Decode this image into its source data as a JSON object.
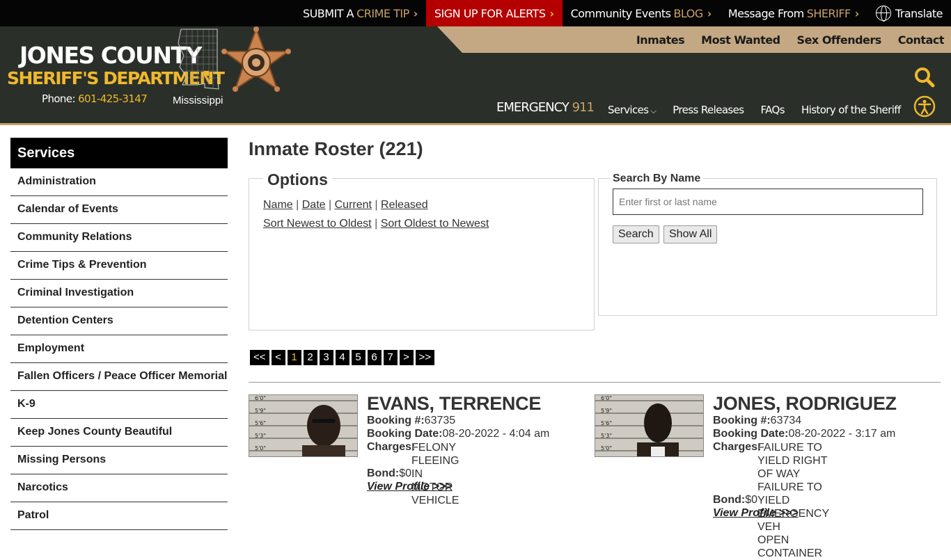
{
  "topbar": {
    "crime_tip_a": "SUBMIT A",
    "crime_tip_b": "CRIME TIP",
    "alerts": "SIGN UP FOR ALERTS",
    "events_a": "Community Events",
    "events_b": "BLOG",
    "message_a": "Message From",
    "message_b": "SHERIFF",
    "translate": "Translate"
  },
  "header": {
    "brand_line1": "JONES COUNTY",
    "brand_line2": "SHERIFF'S DEPARTMENT",
    "phone_label": "Phone:",
    "phone_number": "601-425-3147",
    "state": "Mississippi",
    "emergency_label": "EMERGENCY",
    "emergency_number": "911",
    "secondary_nav": [
      "Inmates",
      "Most Wanted",
      "Sex Offenders",
      "Contact"
    ],
    "main_nav": [
      "Services",
      "Press Releases",
      "FAQs",
      "History of the Sheriff"
    ]
  },
  "sidebar": {
    "heading": "Services",
    "items": [
      "Administration",
      "Calendar of Events",
      "Community Relations",
      "Crime Tips & Prevention",
      "Criminal Investigation",
      "Detention Centers",
      "Employment",
      "Fallen Officers / Peace Officer Memorial",
      "K-9",
      "Keep Jones County Beautiful",
      "Missing Persons",
      "Narcotics",
      "Patrol"
    ]
  },
  "main": {
    "title": "Inmate Roster (221)",
    "options": {
      "legend": "Options",
      "sort_name": "Name",
      "sort_date": "Date",
      "sort_current": "Current",
      "sort_released": "Released",
      "sort_newest": "Sort Newest to Oldest",
      "sort_oldest": "Sort Oldest to Newest",
      "sep": "|"
    },
    "search": {
      "legend": "Search By Name",
      "placeholder": "Enter first or last name",
      "search_button": "Search",
      "show_all_button": "Show All"
    },
    "pager": [
      "<<",
      "<",
      "1",
      "2",
      "3",
      "4",
      "5",
      "6",
      "7",
      ">",
      ">>"
    ],
    "pager_active": "1",
    "labels": {
      "booking_no": "Booking #:",
      "booking_date": "Booking Date:",
      "charges": "Charges:",
      "bond": "Bond:",
      "view_profile": "View Profile >>>"
    },
    "height_marks": [
      "6'0\"",
      "5'9\"",
      "5'6\"",
      "5'3\"",
      "5'0\""
    ],
    "inmates": [
      {
        "name": "EVANS, TERRENCE",
        "booking_no": "63735",
        "booking_date": "08-20-2022 - 4:04 am",
        "charges": [
          "FELONY FLEEING IN MOTOR",
          "VEHICLE"
        ],
        "bond": "$0"
      },
      {
        "name": "JONES, RODRIGUEZ",
        "booking_no": "63734",
        "booking_date": "08-20-2022 - 3:17 am",
        "charges": [
          "FAILURE TO YIELD RIGHT OF WAY",
          "FAILURE TO YIELD EMERGENCY",
          "VEH",
          "OPEN CONTAINER"
        ],
        "bond": "$0"
      }
    ]
  },
  "colors": {
    "header_bg": "#2a3029",
    "gold": "#f0b82d",
    "tan": "#c4a883",
    "alert_red": "#b40000"
  }
}
